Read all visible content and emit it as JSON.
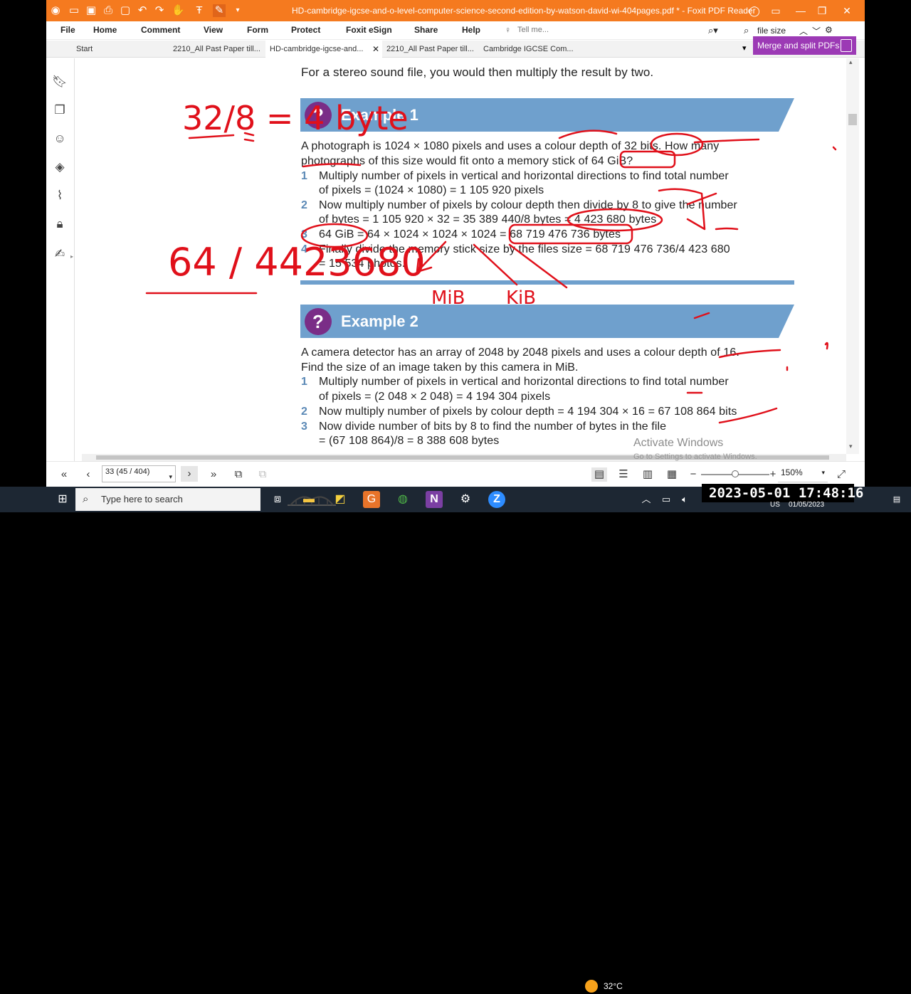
{
  "window": {
    "title": "HD-cambridge-igcse-and-o-level-computer-science-second-edition-by-watson-david-wi-404pages.pdf * - Foxit PDF Reader"
  },
  "menu": {
    "items": [
      "File",
      "Home",
      "Comment",
      "View",
      "Form",
      "Protect",
      "Foxit eSign",
      "Share",
      "Help"
    ],
    "tell_me": "Tell me...",
    "search_value": "file size"
  },
  "tabs": [
    {
      "label": "Start"
    },
    {
      "label": "2210_All Past Paper till..."
    },
    {
      "label": "HD-cambridge-igcse-and..."
    },
    {
      "label": "2210_All Past Paper till..."
    },
    {
      "label": "Cambridge IGCSE Com..."
    }
  ],
  "merge_button": "Merge and split PDFs",
  "document": {
    "intro": "For a stereo sound file, you would then multiply the result by two.",
    "example1": {
      "badge": "?",
      "title": "Example 1",
      "question_line1": "A photograph is 1024 × 1080 pixels and uses a colour depth of 32 bits. How many",
      "question_line2": "photographs of this size would fit onto a memory stick of 64 GiB?",
      "steps": [
        {
          "n": "1",
          "line1": "Multiply number of pixels in vertical and horizontal directions to find total number",
          "line2": "of pixels = (1024 × 1080) = 1 105 920 pixels"
        },
        {
          "n": "2",
          "line1": "Now multiply number of pixels by colour depth then divide by 8 to give the number",
          "line2": "of bytes = 1 105 920 × 32 = 35 389 440/8 bytes = 4 423 680 bytes"
        },
        {
          "n": "3",
          "line1": "64 GiB = 64 × 1024 × 1024 × 1024 = 68 719 476 736 bytes",
          "line2": ""
        },
        {
          "n": "4",
          "line1": "Finally divide the memory stick size by the files size = 68 719 476 736/4 423 680",
          "line2": "= 15 534 photos."
        }
      ]
    },
    "example2": {
      "badge": "?",
      "title": "Example 2",
      "question_line1": "A camera detector has an array of 2048 by 2048 pixels and uses a colour depth of 16.",
      "question_line2": "Find the size of an image taken by this camera in MiB.",
      "steps": [
        {
          "n": "1",
          "line1": "Multiply number of pixels in vertical and horizontal directions to find total number",
          "line2": "of pixels = (2 048 × 2 048) = 4 194 304 pixels"
        },
        {
          "n": "2",
          "line1": "Now multiply number of pixels by colour depth = 4 194 304 × 16 = 67 108 864 bits",
          "line2": ""
        },
        {
          "n": "3",
          "line1": "Now divide number of bits by 8 to find the number of bytes in the file",
          "line2": "= (67 108 864)/8 = 8 388 608 bytes"
        }
      ]
    },
    "handwriting": {
      "left_top": "32/8 = 4 byte",
      "left_bottom": "64 / 4423680",
      "mib": "MiB",
      "kib": "KiB"
    }
  },
  "watermark": {
    "line1": "Activate Windows",
    "line2": "Go to Settings to activate Windows."
  },
  "statusbar": {
    "page_value": "33 (45 / 404)",
    "zoom": "150%",
    "zoom_fraction": 0.5
  },
  "taskbar": {
    "search_placeholder": "Type here to search",
    "weather": "32°C",
    "lang": "US",
    "date": "01/05/2023",
    "clock_overlay": "2023-05-01  17:48:16"
  }
}
